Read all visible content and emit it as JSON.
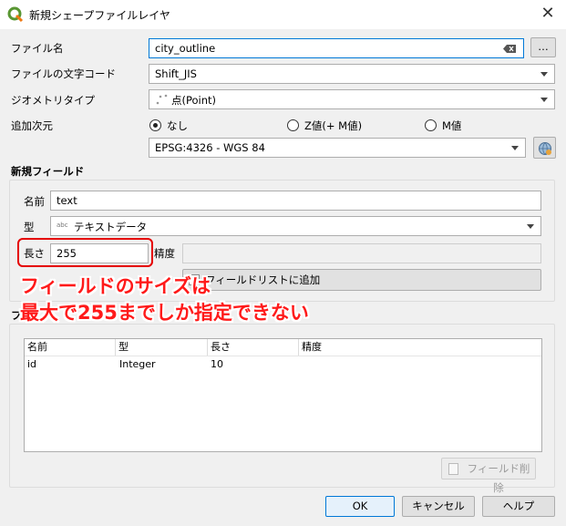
{
  "window": {
    "title": "新規シェープファイルレイヤ"
  },
  "form": {
    "file_name_label": "ファイル名",
    "file_name_value": "city_outline",
    "file_browse_label": "…",
    "encoding_label": "ファイルの文字コード",
    "encoding_value": "Shift_JIS",
    "geometry_label": "ジオメトリタイプ",
    "geometry_value": "点(Point)",
    "dimension_label": "追加次元",
    "dimension_options": [
      "なし",
      "Z値(+ M値)",
      "M値"
    ],
    "crs_value": "EPSG:4326 - WGS 84"
  },
  "new_field": {
    "title": "新規フィールド",
    "name_label": "名前",
    "name_value": "text",
    "type_label": "型",
    "type_icon": "abc",
    "type_value": "テキストデータ",
    "length_label": "長さ",
    "length_value": "255",
    "precision_label": "精度",
    "precision_value": "",
    "add_button": "フィールドリストに追加"
  },
  "field_list": {
    "title": "フ",
    "columns": [
      "名前",
      "型",
      "長さ",
      "精度"
    ],
    "rows": [
      {
        "name": "id",
        "type": "Integer",
        "length": "10",
        "precision": ""
      }
    ],
    "remove_button": "フィールド削除"
  },
  "buttons": {
    "ok": "OK",
    "cancel": "キャンセル",
    "help": "ヘルプ"
  },
  "annotation": {
    "line1": "フィールドのサイズは",
    "line2": "最大で255までしか指定できない",
    "color": "#ff1a1a"
  }
}
